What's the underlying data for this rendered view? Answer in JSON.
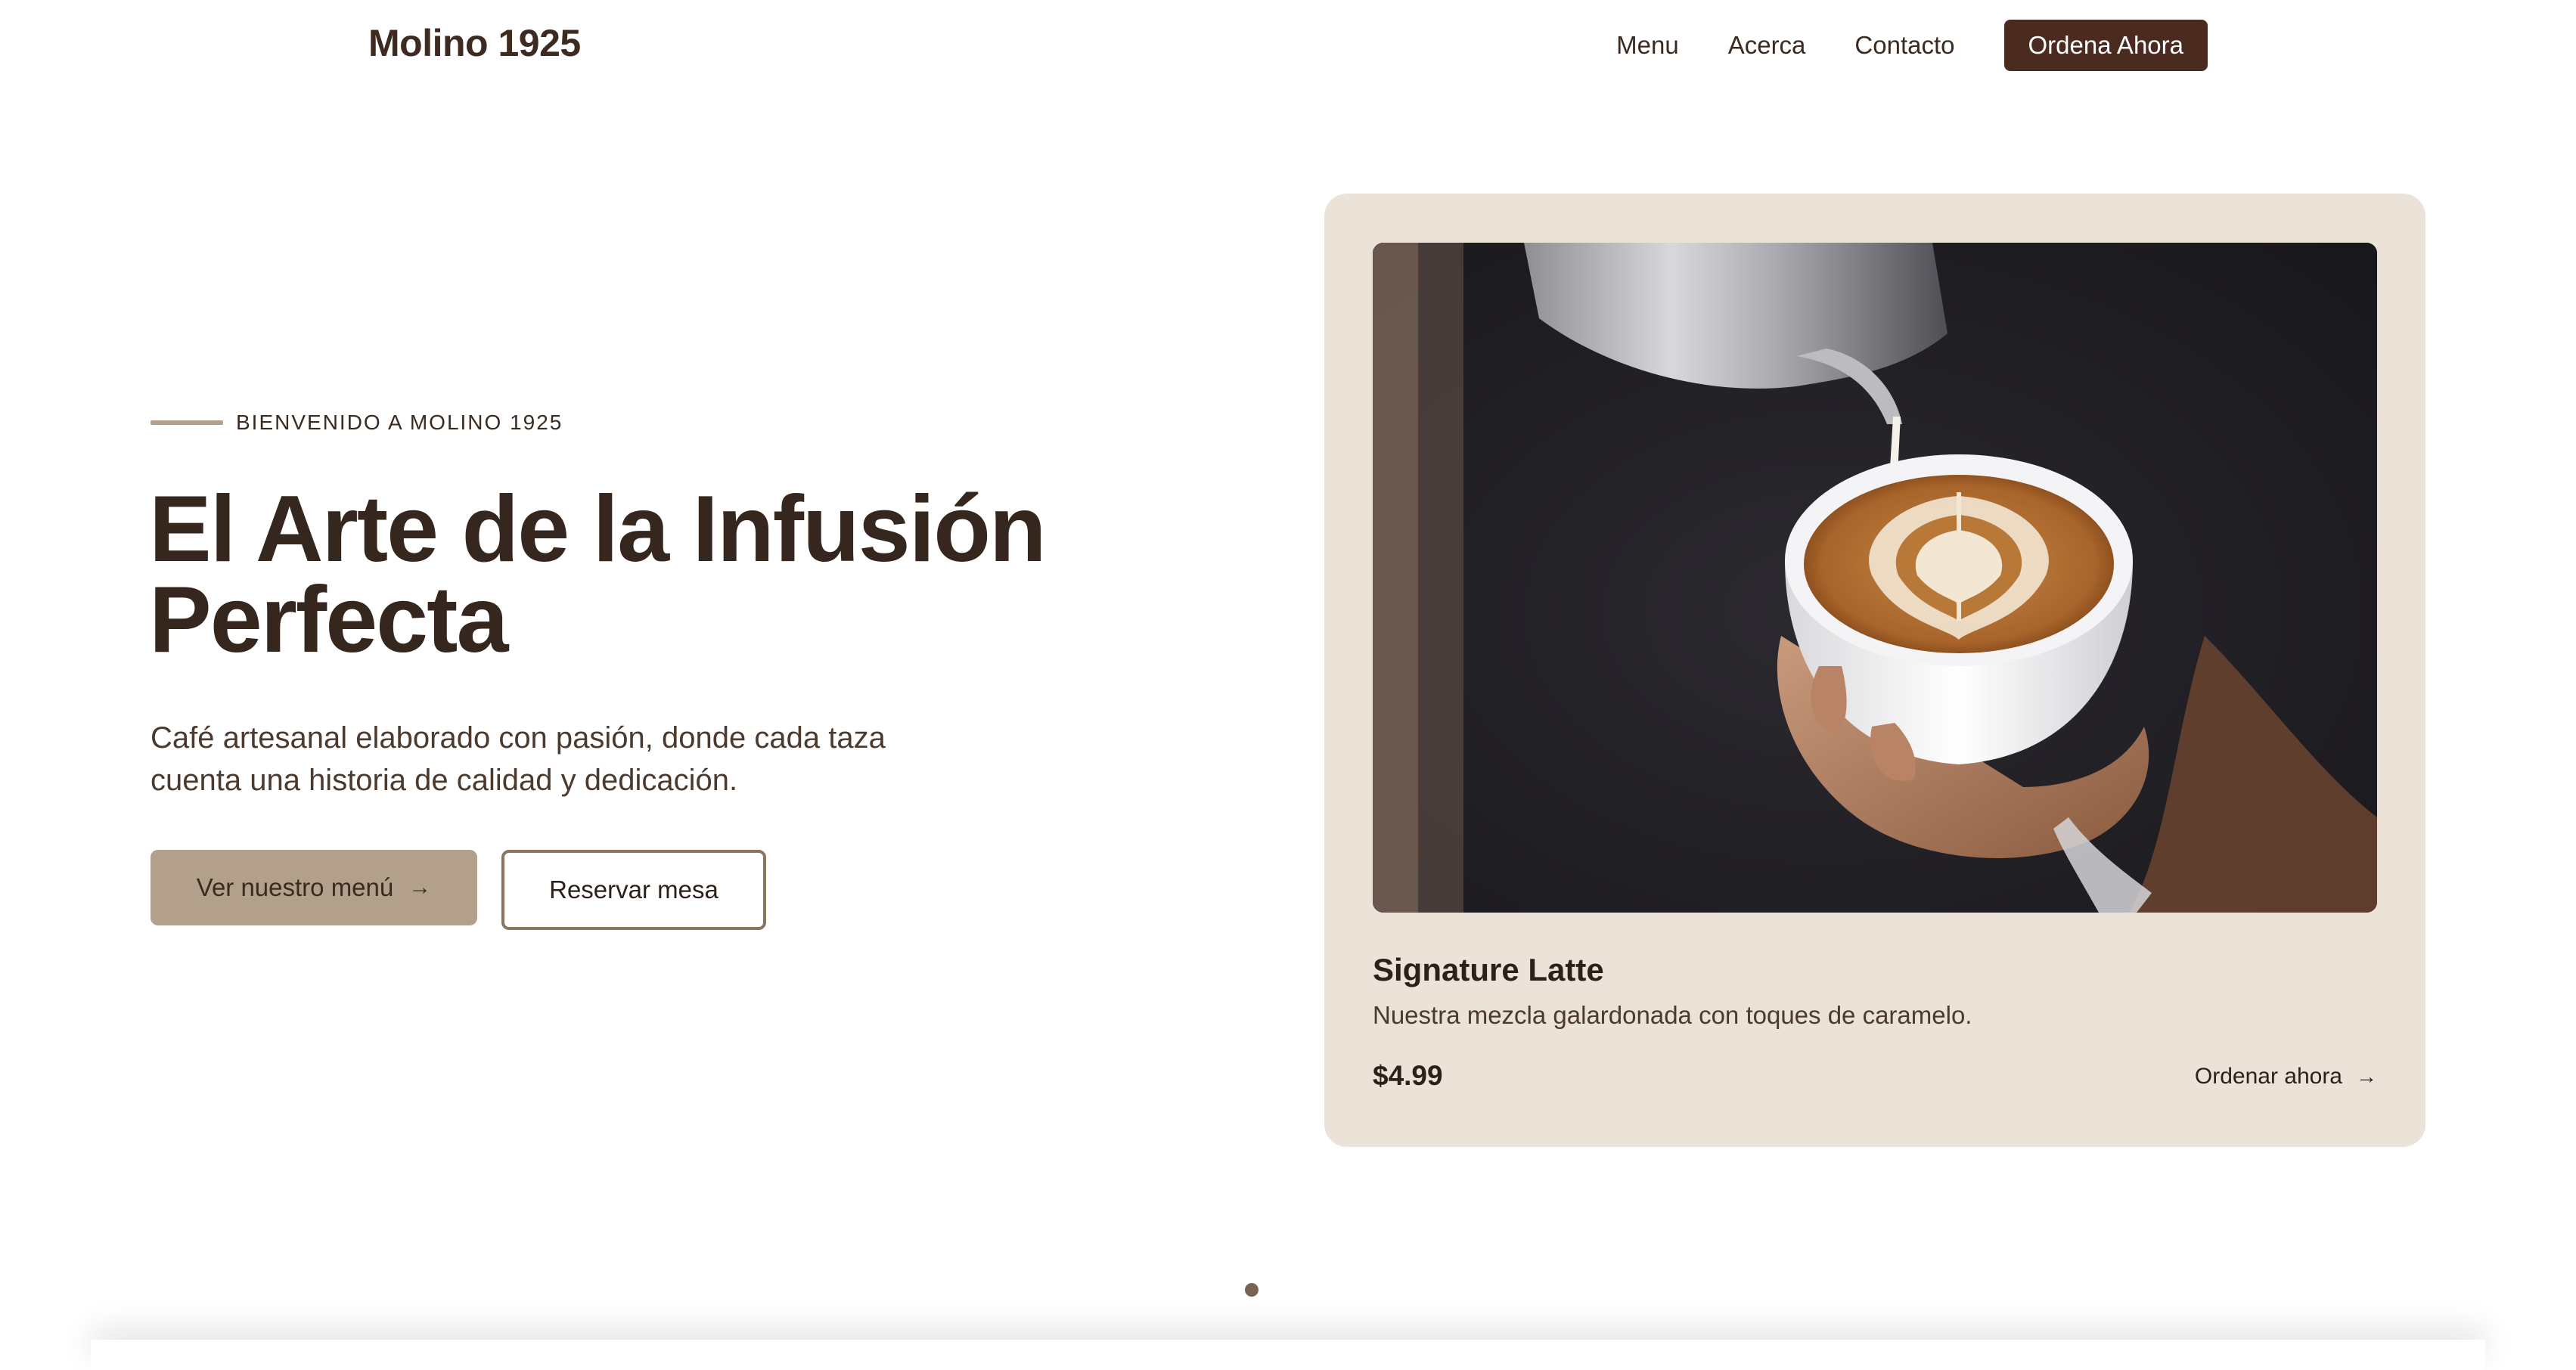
{
  "header": {
    "brand": "Molino 1925",
    "nav": [
      {
        "label": "Menu"
      },
      {
        "label": "Acerca"
      },
      {
        "label": "Contacto"
      }
    ],
    "cta_label": "Ordena Ahora"
  },
  "hero": {
    "eyebrow": "BIENVENIDO A MOLINO 1925",
    "headline_line1": "El Arte de la Infusión",
    "headline_line2": "Perfecta",
    "subtext": "Café artesanal elaborado con pasión, donde cada taza cuenta una historia de calidad y dedicación.",
    "primary_button": "Ver nuestro menú",
    "secondary_button": "Reservar mesa"
  },
  "card": {
    "title": "Signature Latte",
    "description": "Nuestra mezcla galardonada con toques de caramelo.",
    "price": "$4.99",
    "link_label": "Ordenar ahora",
    "image_subject": "latte-art-photo"
  },
  "icons": {
    "arrow": "arrow-right-icon",
    "carousel_dot": "carousel-dot"
  },
  "colors": {
    "brand_dark": "#4b2b20",
    "accent_tan": "#b3a08b",
    "card_bg": "#ebe2d8",
    "text_dark": "#3a2a20"
  }
}
